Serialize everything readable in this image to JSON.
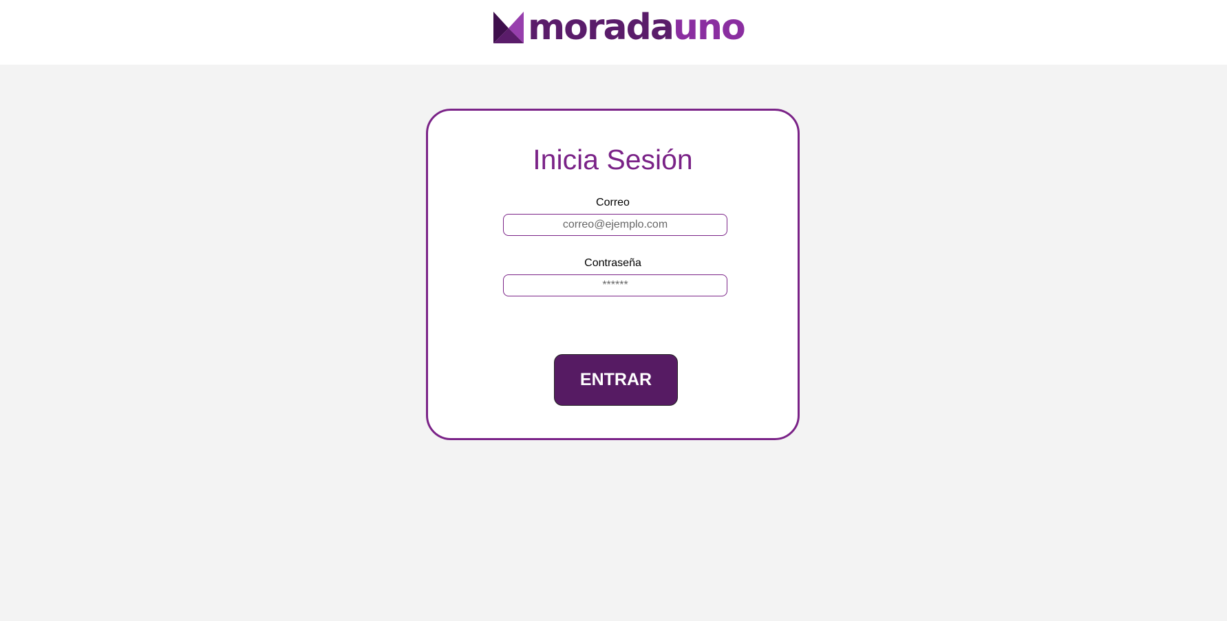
{
  "brand": {
    "name_part1": "morada",
    "name_part2": "uno",
    "primary_color": "#7a2287",
    "button_color": "#561b63"
  },
  "login": {
    "title": "Inicia Sesión",
    "email": {
      "label": "Correo",
      "placeholder": "correo@ejemplo.com",
      "value": ""
    },
    "password": {
      "label": "Contraseña",
      "placeholder": "******",
      "value": ""
    },
    "submit_label": "ENTRAR"
  },
  "icons": {
    "logo": "moradauno-logo-mark"
  }
}
